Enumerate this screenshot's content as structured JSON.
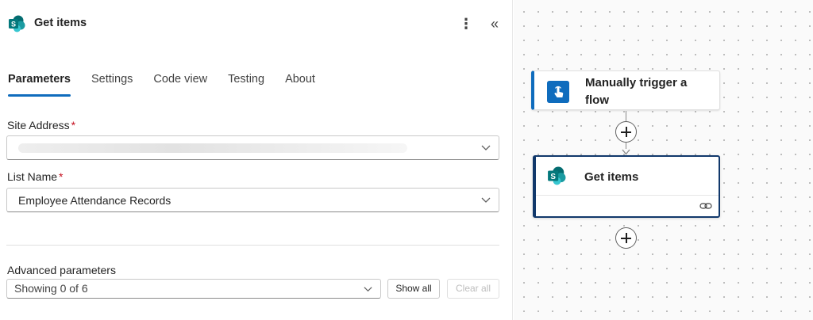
{
  "panel": {
    "title": "Get items",
    "more_glyph": "⋮",
    "collapse_glyph": "«",
    "tabs": [
      {
        "label": "Parameters",
        "active": true
      },
      {
        "label": "Settings",
        "active": false
      },
      {
        "label": "Code view",
        "active": false
      },
      {
        "label": "Testing",
        "active": false
      },
      {
        "label": "About",
        "active": false
      }
    ],
    "site_address": {
      "label": "Site Address",
      "required_mark": "*",
      "value": ""
    },
    "list_name": {
      "label": "List Name",
      "required_mark": "*",
      "value": "Employee Attendance Records"
    },
    "advanced": {
      "label": "Advanced parameters",
      "selected": "Showing 0 of 6",
      "show_all_label": "Show all",
      "clear_all_label": "Clear all"
    }
  },
  "canvas": {
    "nodes": [
      {
        "title": "Manually trigger a flow",
        "icon": "manual-trigger-icon"
      },
      {
        "title": "Get items",
        "icon": "sharepoint-icon"
      }
    ]
  },
  "colors": {
    "accent": "#0f6cbd",
    "selected_node_border": "#11386b",
    "sharepoint_teal": "#038387",
    "required": "#c50f1f"
  }
}
